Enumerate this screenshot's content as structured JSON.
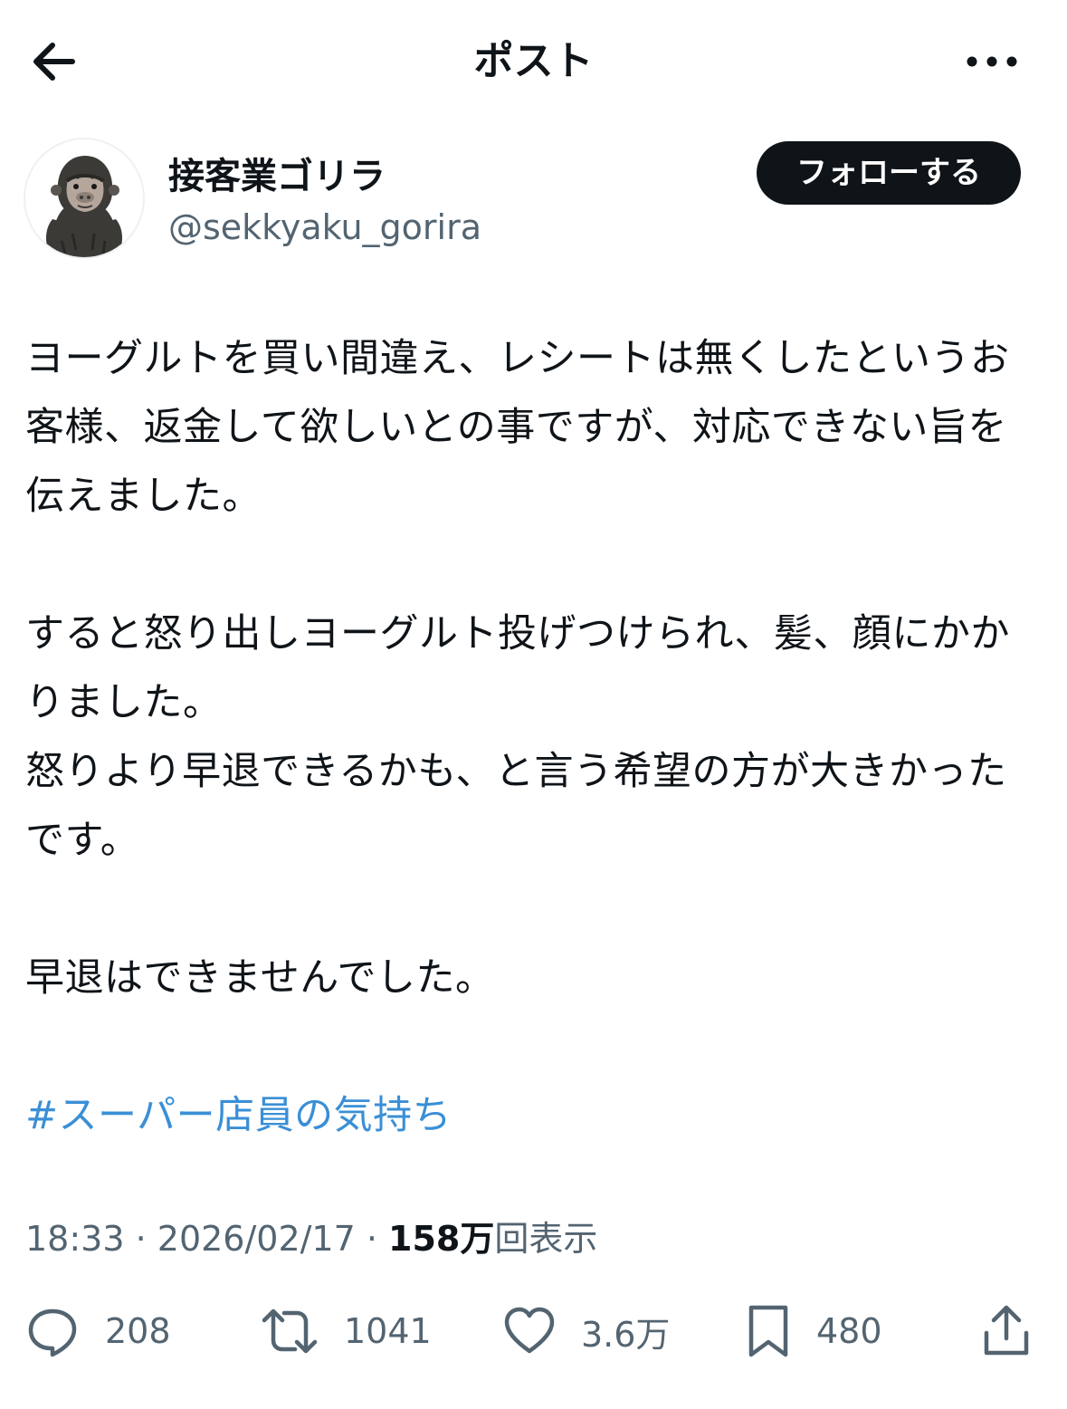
{
  "header": {
    "title": "ポスト",
    "back_icon": "arrow-left-icon",
    "more_icon": "more-dots-icon"
  },
  "author": {
    "display_name": "接客業ゴリラ",
    "handle": "@sekkyaku_gorira",
    "avatar_icon": "gorilla-avatar",
    "follow_label": "フォローする"
  },
  "tweet": {
    "paragraphs": [
      "ヨーグルトを買い間違え、レシートは無くしたというお客様、返金して欲しいとの事ですが、対応できない旨を伝えました。",
      "すると怒り出しヨーグルト投げつけられ、髪、顔にかかりました。",
      "怒りより早退できるかも、と言う希望の方が大きかったです。",
      "早退はできませんでした。"
    ],
    "hashtag": "#スーパー店員の気持ち"
  },
  "meta": {
    "time": "18:33",
    "separator": " · ",
    "date": "2026/02/17",
    "views_number": "158",
    "views_unit": "万",
    "views_label": "回表示"
  },
  "actions": {
    "reply_count": "208",
    "retweet_count": "1041",
    "like_count": "3.6万",
    "bookmark_count": "480"
  },
  "colors": {
    "text": "#0f1419",
    "secondary": "#536471",
    "hashtag": "#3a8fd6",
    "follow_bg": "#0f1419"
  }
}
